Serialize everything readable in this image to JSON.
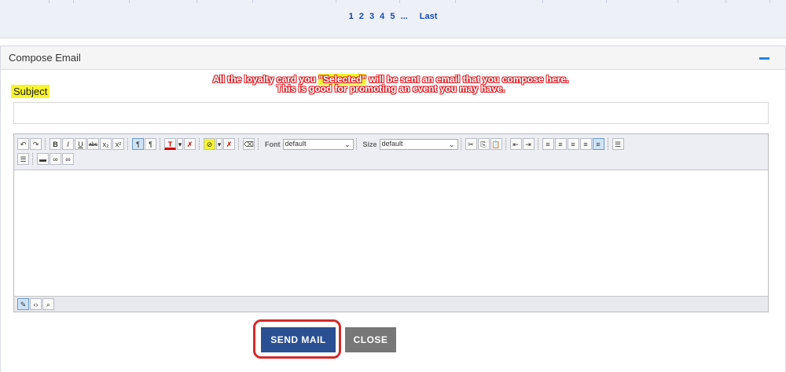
{
  "pager": {
    "pages": [
      "1",
      "2",
      "3",
      "4",
      "5",
      "..."
    ],
    "last_label": "Last",
    "active_page": "1"
  },
  "panel": {
    "title": "Compose Email"
  },
  "subject": {
    "label": "Subject",
    "value": ""
  },
  "annotation": {
    "line1_a": "All the loyalty card you ",
    "line1_hl": "\"Selected\"",
    "line1_b": " will be sent an email that you compose here.",
    "line2": "This is good for promoting an event you may have."
  },
  "toolbar": {
    "font_label": "Font",
    "font_value": "default",
    "size_label": "Size",
    "size_value": "default",
    "bold": "B",
    "italic": "I",
    "underline": "U",
    "strike": "abc",
    "sub": "x₂",
    "sup": "x²",
    "text_color": "T",
    "clear": "✗"
  },
  "buttons": {
    "send": "SEND MAIL",
    "close": "CLOSE"
  },
  "colors": {
    "accent": "#2a4f93",
    "highlight": "#f7f42b",
    "annotation": "#d8232a"
  }
}
